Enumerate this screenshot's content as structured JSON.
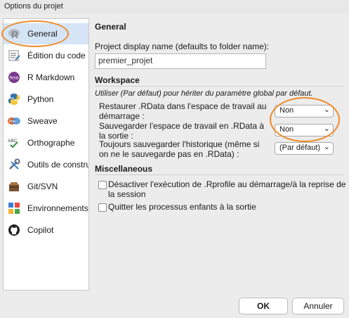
{
  "window": {
    "title": "Options du projet"
  },
  "sidebar": {
    "items": [
      {
        "label": "General",
        "icon": "r-logo-icon"
      },
      {
        "label": "Édition du code",
        "icon": "code-edit-icon"
      },
      {
        "label": "R Markdown",
        "icon": "rmd-icon"
      },
      {
        "label": "Python",
        "icon": "python-icon"
      },
      {
        "label": "Sweave",
        "icon": "sweave-icon"
      },
      {
        "label": "Orthographe",
        "icon": "spelling-icon"
      },
      {
        "label": "Outils de construction",
        "icon": "build-tools-icon"
      },
      {
        "label": "Git/SVN",
        "icon": "git-icon"
      },
      {
        "label": "Environnements",
        "icon": "environments-icon"
      },
      {
        "label": "Copilot",
        "icon": "copilot-icon"
      }
    ]
  },
  "general": {
    "title": "General",
    "name_label": "Project display name (defaults to folder name):",
    "name_value": "premier_projet"
  },
  "workspace": {
    "title": "Workspace",
    "hint": "Utiliser (Par défaut) pour hériter du paramètre global par défaut.",
    "restore_label": "Restaurer .RData dans l'espace de travail au démarrage :",
    "restore_value": "Non",
    "save_label": "Sauvegarder l'espace de travail en .RData à la sortie :",
    "save_value": "Non",
    "history_label": "Toujours sauvegarder l'historique (même si on ne le sauvegarde pas en .RData) :",
    "history_value": "(Par défaut)"
  },
  "misc": {
    "title": "Miscellaneous",
    "rprofile_label": "Désactiver l'exécution de .Rprofile au démarrage/à la reprise de la session",
    "rprofile_checked": false,
    "quit_children_label": "Quitter les processus enfants à la sortie",
    "quit_children_checked": false
  },
  "buttons": {
    "ok": "OK",
    "cancel": "Annuler"
  },
  "colors": {
    "highlight": "#f08a28",
    "selection": "#d5e5f6"
  }
}
